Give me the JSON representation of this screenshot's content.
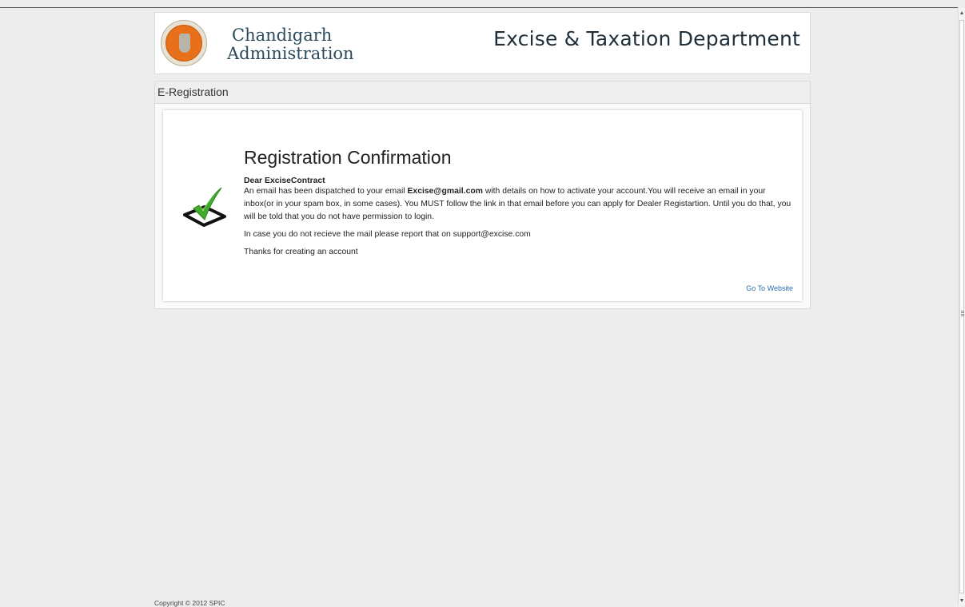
{
  "header": {
    "logo_line1": "Chandigarh",
    "logo_line2": "Administration",
    "department": "Excise & Taxation Department"
  },
  "panel": {
    "title": "E-Registration"
  },
  "confirmation": {
    "title": "Registration Confirmation",
    "greeting": "Dear ExciseContract",
    "body_prefix": "An email has been dispatched to your email ",
    "email": "Excise@gmail.com",
    "body_suffix": " with details on how to activate your account.You will receive an email in your inbox(or in your spam box, in some cases). You MUST follow the link in that email before you can apply for Dealer Registartion. Until you do that, you will be told that you do not have permission to login.",
    "support_note": "In case you do not recieve the mail please report that on support@excise.com",
    "thanks": "Thanks for creating an account",
    "go_to_website": "Go To Website"
  },
  "footer": {
    "copyright": "Copyright © 2012 SPIC"
  },
  "colors": {
    "background": "#ededed",
    "link": "#2a6fb0",
    "check_green": "#3fae2a",
    "seal_orange": "#e8701a"
  }
}
